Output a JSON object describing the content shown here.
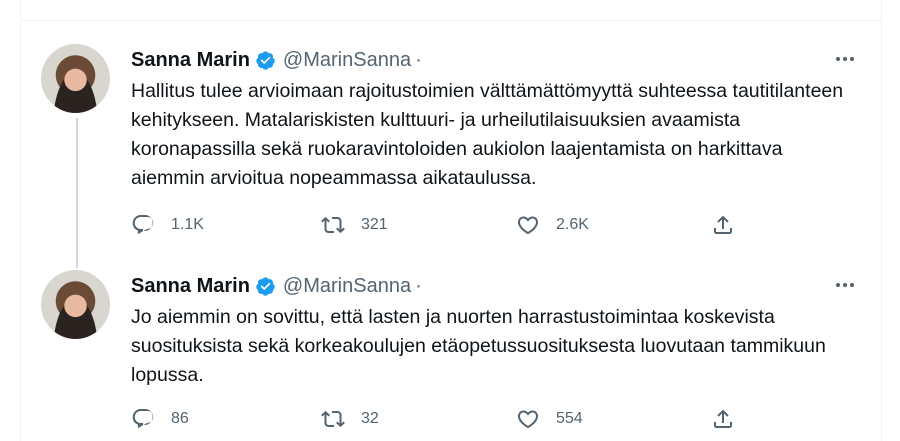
{
  "thread": [
    {
      "author_name": "Sanna Marin",
      "handle": "@MarinSanna",
      "separator": "·",
      "text": "Hallitus tulee arvioimaan rajoitustoimien välttämättömyyttä suhteessa tautitilanteen kehitykseen. Matalariskisten kulttuuri- ja urheilutilaisuuksien avaamista koronapassilla sekä ruokaravintoloiden aukiolon laajentamista on harkittava aiemmin arvioitua nopeammassa aikataulussa.",
      "replies": "1.1K",
      "retweets": "321",
      "likes": "2.6K"
    },
    {
      "author_name": "Sanna Marin",
      "handle": "@MarinSanna",
      "separator": "·",
      "text": "Jo aiemmin on sovittu, että lasten ja nuorten harrastustoimintaa koskevista suosituksista sekä korkeakoulujen etäopetussuosituksesta luovutaan tammikuun lopussa.",
      "replies": "86",
      "retweets": "32",
      "likes": "554"
    }
  ],
  "icons": {
    "verified": "verified-badge-icon",
    "more": "more-options-icon",
    "reply": "reply-icon",
    "retweet": "retweet-icon",
    "like": "like-icon",
    "share": "share-icon"
  },
  "colors": {
    "verified_blue": "#1d9bf0",
    "text_primary": "#0f1419",
    "text_secondary": "#536471",
    "thread_line": "#cfd9de",
    "divider": "#eff3f4"
  }
}
